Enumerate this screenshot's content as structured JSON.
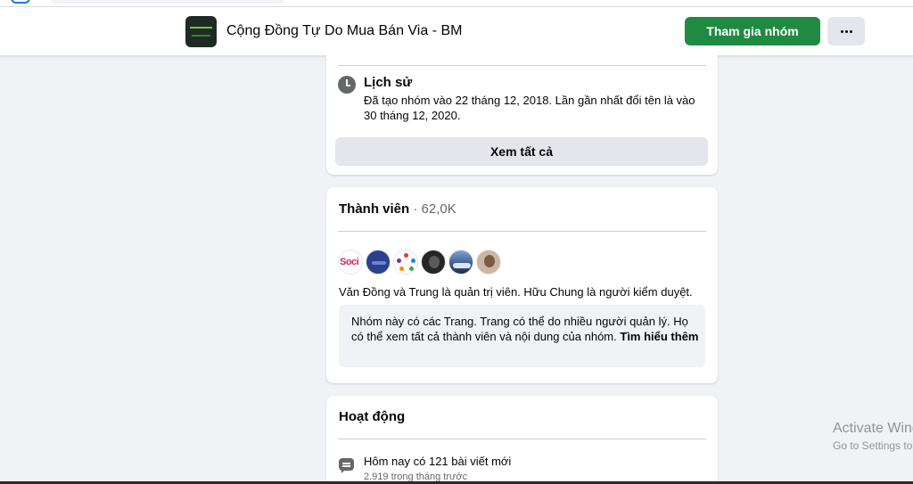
{
  "header": {
    "group_name": "Cộng Đồng Tự Do Mua Bán Via - BM",
    "join_label": "Tham gia nhóm",
    "more_icon": "more-horizontal-icon",
    "avatar_logo_icon": "group-logo"
  },
  "history": {
    "icon": "clock-icon",
    "title": "Lịch sử",
    "text": "Đã tạo nhóm vào 22 tháng 12, 2018. Lần gần nhất đổi tên là vào 30 tháng 12, 2020.",
    "see_all_label": "Xem tất cả"
  },
  "members": {
    "title": "Thành viên",
    "separator": "·",
    "count": "62,0K",
    "avatar_1_text": "Soci",
    "admins_text": "Văn Đồng và Trung là quản trị viên. Hữu Chung là người kiểm duyệt.",
    "pages_info": "Nhóm này có các Trang. Trang có thể do nhiều người quản lý. Họ có thể xem tất cả thành viên và nội dung của nhóm.",
    "learn_more": "Tìm hiểu thêm"
  },
  "activity": {
    "title": "Hoạt động",
    "icon": "chat-bubble-icon",
    "today_posts": "Hôm nay có 121 bài viết mới",
    "last_month": "2.919 trong tháng trước"
  },
  "watermark": {
    "title": "Activate Windows",
    "subtitle": "Go to Settings to activate Windows."
  },
  "colors": {
    "primary_button": "#1f8a42",
    "background": "#f0f2f5",
    "secondary_button": "#e4e6eb",
    "secondary_text": "#65676b"
  }
}
